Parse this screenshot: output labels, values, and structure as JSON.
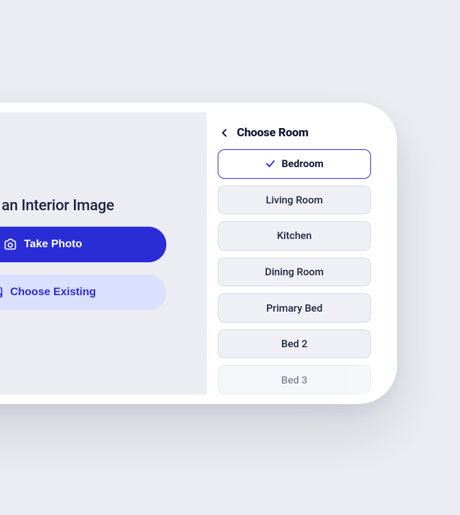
{
  "left": {
    "title": "Add an Interior Image",
    "take_photo_label": "Take Photo",
    "choose_existing_label": "Choose Existing"
  },
  "right": {
    "header": "Choose Room",
    "rooms": [
      {
        "label": "Bedroom",
        "selected": true
      },
      {
        "label": "Living Room",
        "selected": false
      },
      {
        "label": "Kitchen",
        "selected": false
      },
      {
        "label": "Dining Room",
        "selected": false
      },
      {
        "label": "Primary Bed",
        "selected": false
      },
      {
        "label": "Bed 2",
        "selected": false
      },
      {
        "label": "Bed 3",
        "selected": false
      }
    ]
  },
  "colors": {
    "primary": "#2a2cd6",
    "secondary_bg": "#dbe0ff",
    "panel_bg": "#ecedf2",
    "room_btn_bg": "#eef0f5",
    "room_btn_border": "#d5d9e6",
    "text": "#1e2340"
  }
}
